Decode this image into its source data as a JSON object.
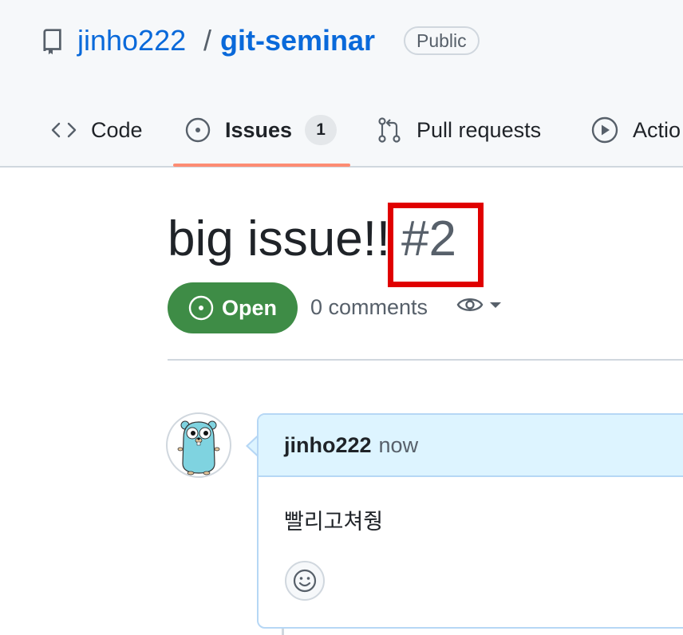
{
  "repo": {
    "owner": "jinho222",
    "separator": "/",
    "name": "git-seminar",
    "visibility": "Public"
  },
  "tabs": [
    {
      "label": "Code",
      "icon": "code-icon"
    },
    {
      "label": "Issues",
      "icon": "issue-opened-icon",
      "count": "1",
      "selected": true
    },
    {
      "label": "Pull requests",
      "icon": "git-pull-request-icon"
    },
    {
      "label": "Actio",
      "icon": "play-icon"
    }
  ],
  "issue": {
    "title": "big issue!!",
    "number": "#2",
    "state": "Open",
    "comments": "0 comments"
  },
  "comment": {
    "author": "jinho222",
    "time": "now",
    "body": "빨리고쳐줭"
  },
  "colors": {
    "link": "#0969da",
    "open_state": "#3e8c46",
    "highlight_box": "#e00000",
    "tab_underline": "#fd8c73",
    "comment_header": "#ddf4ff"
  }
}
